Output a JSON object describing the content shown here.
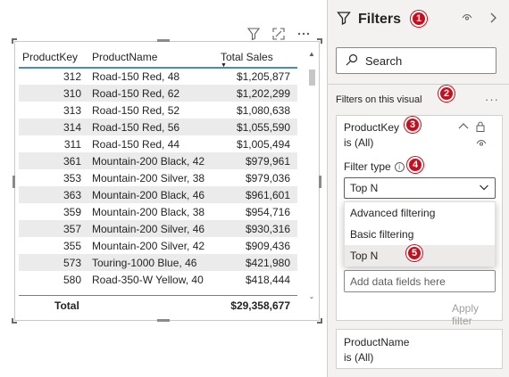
{
  "visual": {
    "columns": [
      "ProductKey",
      "ProductName",
      "Total Sales"
    ],
    "rows": [
      {
        "key": "312",
        "name": "Road-150 Red, 48",
        "sales": "$1,205,877"
      },
      {
        "key": "310",
        "name": "Road-150 Red, 62",
        "sales": "$1,202,299"
      },
      {
        "key": "313",
        "name": "Road-150 Red, 52",
        "sales": "$1,080,638"
      },
      {
        "key": "314",
        "name": "Road-150 Red, 56",
        "sales": "$1,055,590"
      },
      {
        "key": "311",
        "name": "Road-150 Red, 44",
        "sales": "$1,005,494"
      },
      {
        "key": "361",
        "name": "Mountain-200 Black, 42",
        "sales": "$979,961"
      },
      {
        "key": "353",
        "name": "Mountain-200 Silver, 38",
        "sales": "$979,036"
      },
      {
        "key": "363",
        "name": "Mountain-200 Black, 46",
        "sales": "$961,601"
      },
      {
        "key": "359",
        "name": "Mountain-200 Black, 38",
        "sales": "$954,716"
      },
      {
        "key": "357",
        "name": "Mountain-200 Silver, 46",
        "sales": "$930,316"
      },
      {
        "key": "355",
        "name": "Mountain-200 Silver, 42",
        "sales": "$909,436"
      },
      {
        "key": "573",
        "name": "Touring-1000 Blue, 46",
        "sales": "$421,980"
      },
      {
        "key": "580",
        "name": "Road-350-W Yellow, 40",
        "sales": "$418,444"
      }
    ],
    "total_label": "Total",
    "total_value": "$29,358,677"
  },
  "filters": {
    "title": "Filters",
    "search_placeholder": "Search",
    "section_label": "Filters on this visual",
    "card1": {
      "field": "ProductKey",
      "value": "is (All)",
      "filter_type_label": "Filter type",
      "selected_type": "Top N",
      "options": [
        "Advanced filtering",
        "Basic filtering",
        "Top N"
      ],
      "add_field_placeholder": "Add data fields here",
      "apply_label": "Apply filter"
    },
    "card2": {
      "field": "ProductName",
      "value": "is (All)"
    }
  },
  "badges": [
    "1",
    "2",
    "3",
    "4",
    "5"
  ],
  "colors": {
    "badge_red": "#c50f1f",
    "header_underline": "#4c8bb4",
    "pane_bg": "#f3f2f1"
  }
}
